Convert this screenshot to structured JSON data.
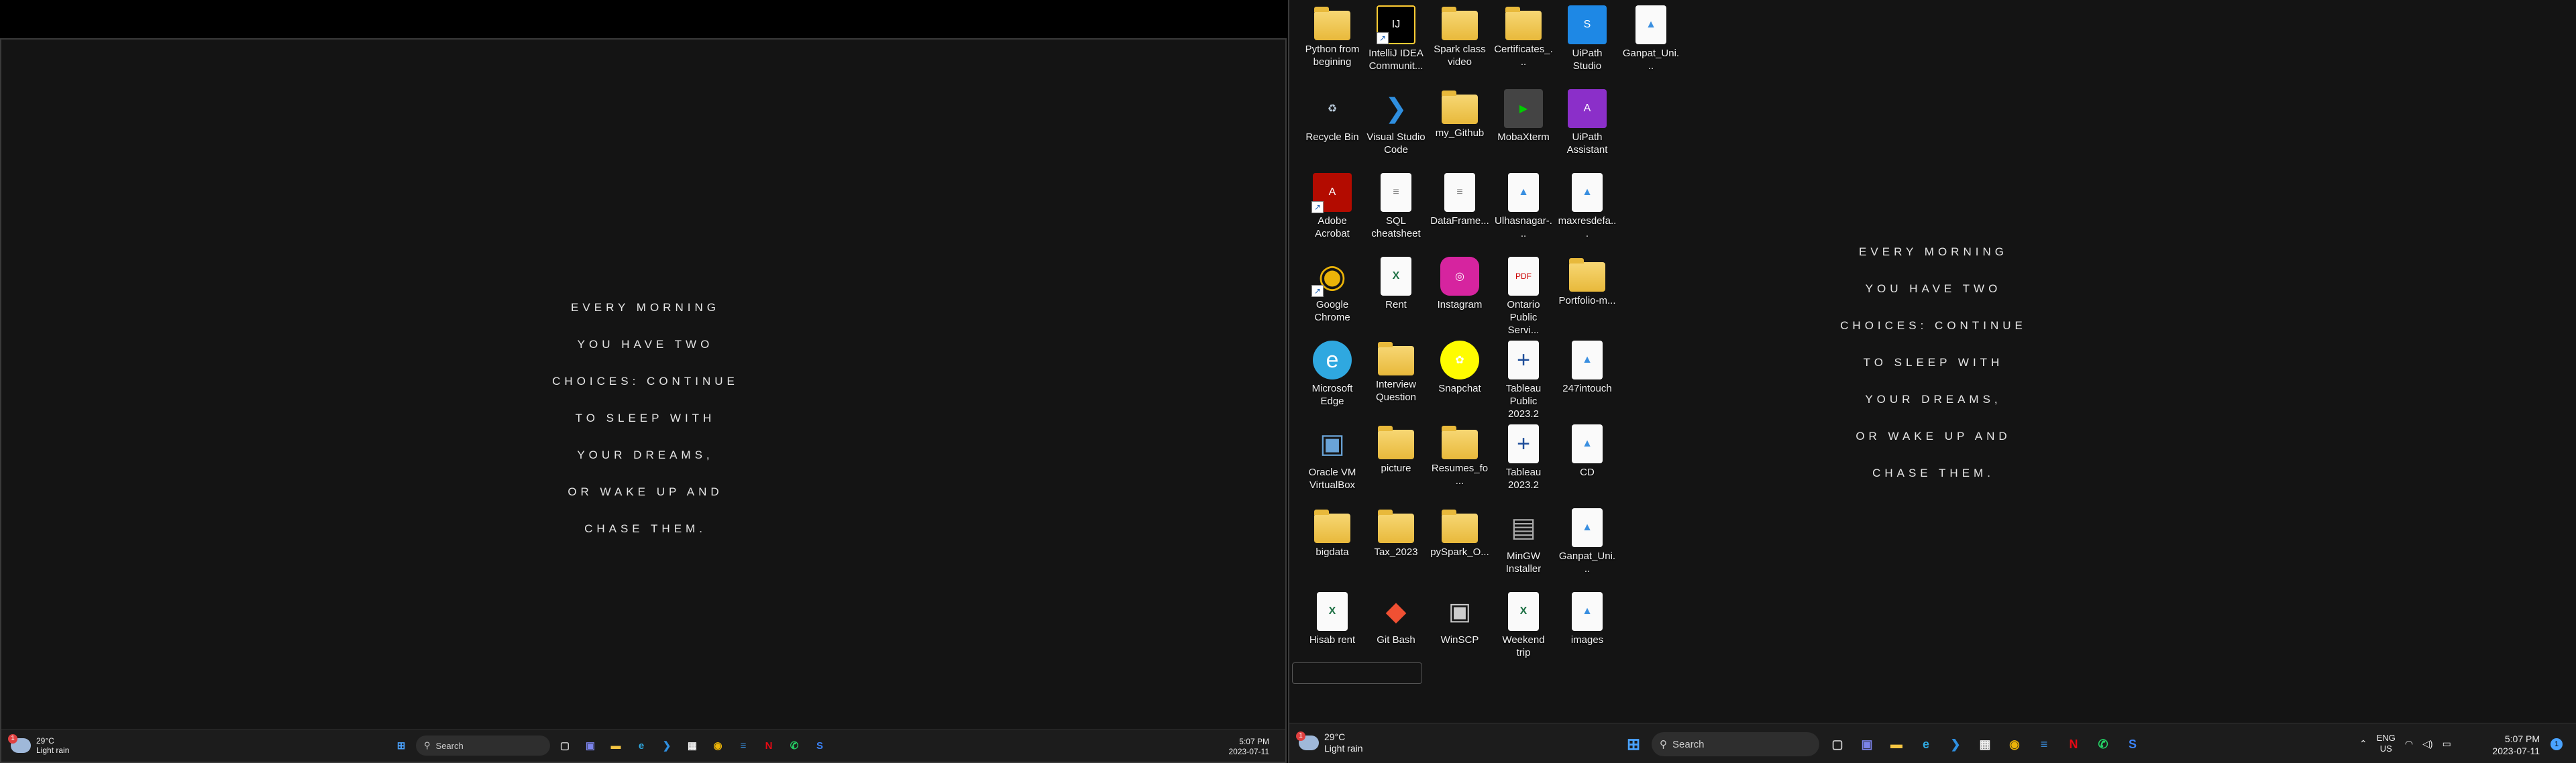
{
  "quote_lines": [
    "EVERY MORNING",
    "YOU HAVE TWO",
    "CHOICES: CONTINUE",
    "TO SLEEP WITH",
    "YOUR DREAMS,",
    "OR WAKE UP AND",
    "CHASE THEM."
  ],
  "weather": {
    "temp": "29°C",
    "condition": "Light rain"
  },
  "search": {
    "label": "Search"
  },
  "clock": {
    "time": "5:07 PM",
    "date": "2023-07-11"
  },
  "tray": {
    "lang_top": "ENG",
    "lang_bottom": "US",
    "notifications": "1"
  },
  "desktop_icons": [
    {
      "label": "Python from begining",
      "icon": "folder-icon"
    },
    {
      "label": "IntelliJ IDEA Communit...",
      "icon": "intellij-icon"
    },
    {
      "label": "Spark class video",
      "icon": "folder-icon"
    },
    {
      "label": "Certificates_...",
      "icon": "folder-icon"
    },
    {
      "label": "UiPath Studio",
      "icon": "uipath-studio-icon"
    },
    {
      "label": "Ganpat_Uni...",
      "icon": "image-file-icon"
    },
    {
      "label": "Recycle Bin",
      "icon": "recycle-bin-icon"
    },
    {
      "label": "Visual Studio Code",
      "icon": "vscode-icon"
    },
    {
      "label": "my_Github",
      "icon": "folder-icon"
    },
    {
      "label": "MobaXterm",
      "icon": "mobaxterm-icon"
    },
    {
      "label": "UiPath Assistant",
      "icon": "uipath-assistant-icon"
    },
    {
      "label": "Adobe Acrobat",
      "icon": "acrobat-icon"
    },
    {
      "label": "SQL cheatsheet",
      "icon": "doc-file-icon"
    },
    {
      "label": "DataFrame...",
      "icon": "doc-file-icon"
    },
    {
      "label": "Ulhasnagar-...",
      "icon": "image-file-icon"
    },
    {
      "label": "maxresdefa...",
      "icon": "image-file-icon"
    },
    {
      "label": "Google Chrome",
      "icon": "chrome-icon"
    },
    {
      "label": "Rent",
      "icon": "excel-file-icon"
    },
    {
      "label": "Instagram",
      "icon": "instagram-icon"
    },
    {
      "label": "Ontario Public Servi...",
      "icon": "pdf-file-icon"
    },
    {
      "label": "Portfolio-m...",
      "icon": "folder-icon"
    },
    {
      "label": "Microsoft Edge",
      "icon": "edge-icon"
    },
    {
      "label": "Interview Question",
      "icon": "folder-icon"
    },
    {
      "label": "Snapchat",
      "icon": "snapchat-icon"
    },
    {
      "label": "Tableau Public 2023.2",
      "icon": "tableau-icon"
    },
    {
      "label": "247intouch",
      "icon": "image-file-icon"
    },
    {
      "label": "Oracle VM VirtualBox",
      "icon": "virtualbox-icon"
    },
    {
      "label": "picture",
      "icon": "folder-icon"
    },
    {
      "label": "Resumes_fo...",
      "icon": "folder-icon"
    },
    {
      "label": "Tableau 2023.2",
      "icon": "tableau-icon"
    },
    {
      "label": "CD",
      "icon": "image-file-icon"
    },
    {
      "label": "bigdata",
      "icon": "folder-icon"
    },
    {
      "label": "Tax_2023",
      "icon": "folder-icon"
    },
    {
      "label": "pySpark_O...",
      "icon": "folder-icon"
    },
    {
      "label": "MinGW Installer",
      "icon": "mingw-icon"
    },
    {
      "label": "Ganpat_Uni...",
      "icon": "image-file-icon"
    },
    {
      "label": "Hisab rent",
      "icon": "excel-file-icon"
    },
    {
      "label": "Git Bash",
      "icon": "git-bash-icon"
    },
    {
      "label": "WinSCP",
      "icon": "winscp-icon"
    },
    {
      "label": "Weekend trip",
      "icon": "excel-file-icon"
    },
    {
      "label": "images",
      "icon": "image-file-icon"
    }
  ],
  "taskbar_apps": [
    {
      "name": "task-view",
      "glyph": "▢",
      "color": "#cfcfcf"
    },
    {
      "name": "teams",
      "glyph": "▣",
      "color": "#7b83eb"
    },
    {
      "name": "file-explorer",
      "glyph": "▬",
      "color": "#f4c542"
    },
    {
      "name": "edge",
      "glyph": "e",
      "color": "#2fa8e0"
    },
    {
      "name": "vscode",
      "glyph": "❯",
      "color": "#2f8fe0"
    },
    {
      "name": "store",
      "glyph": "▦",
      "color": "#f2f2f2"
    },
    {
      "name": "chrome",
      "glyph": "◉",
      "color": "#eab308"
    },
    {
      "name": "notepad",
      "glyph": "≡",
      "color": "#3a8fe0"
    },
    {
      "name": "netflix",
      "glyph": "N",
      "color": "#e50914"
    },
    {
      "name": "whatsapp",
      "glyph": "✆",
      "color": "#25d366"
    },
    {
      "name": "uipath",
      "glyph": "S",
      "color": "#3b82f6"
    }
  ]
}
